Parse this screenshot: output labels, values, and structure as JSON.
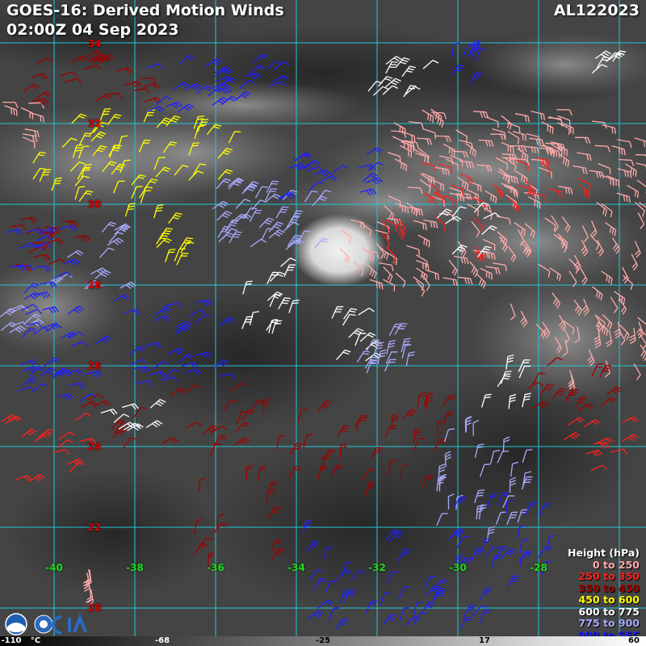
{
  "header": {
    "title_line1": "GOES-16: Derived Motion Winds",
    "title_line2": "02:00Z 04 Sep 2023",
    "storm_id": "AL122023"
  },
  "grid": {
    "lat_labels": [
      "34",
      "32",
      "30",
      "28",
      "26",
      "24",
      "22",
      "20"
    ],
    "lon_labels": [
      "-40",
      "-38",
      "-36",
      "-34",
      "-32",
      "-30",
      "-28"
    ],
    "line_color": "#20c8d8"
  },
  "legend": {
    "title": "Height (hPa)",
    "items": [
      {
        "label": "0 to 250",
        "color": "#ffaaaa"
      },
      {
        "label": "250 to 350",
        "color": "#ff2020"
      },
      {
        "label": "350 to 450",
        "color": "#a00000"
      },
      {
        "label": "450 to 600",
        "color": "#ffff00"
      },
      {
        "label": "600 to 775",
        "color": "#ffffff"
      },
      {
        "label": "775 to 900",
        "color": "#aaaaff"
      },
      {
        "label": "900 to SFC",
        "color": "#2020ff"
      }
    ]
  },
  "colorbar": {
    "labels": [
      "-110",
      "°C",
      "-68",
      "-25",
      "17",
      "60"
    ]
  },
  "logos": [
    "noaa-logo",
    "cira-logo"
  ]
}
